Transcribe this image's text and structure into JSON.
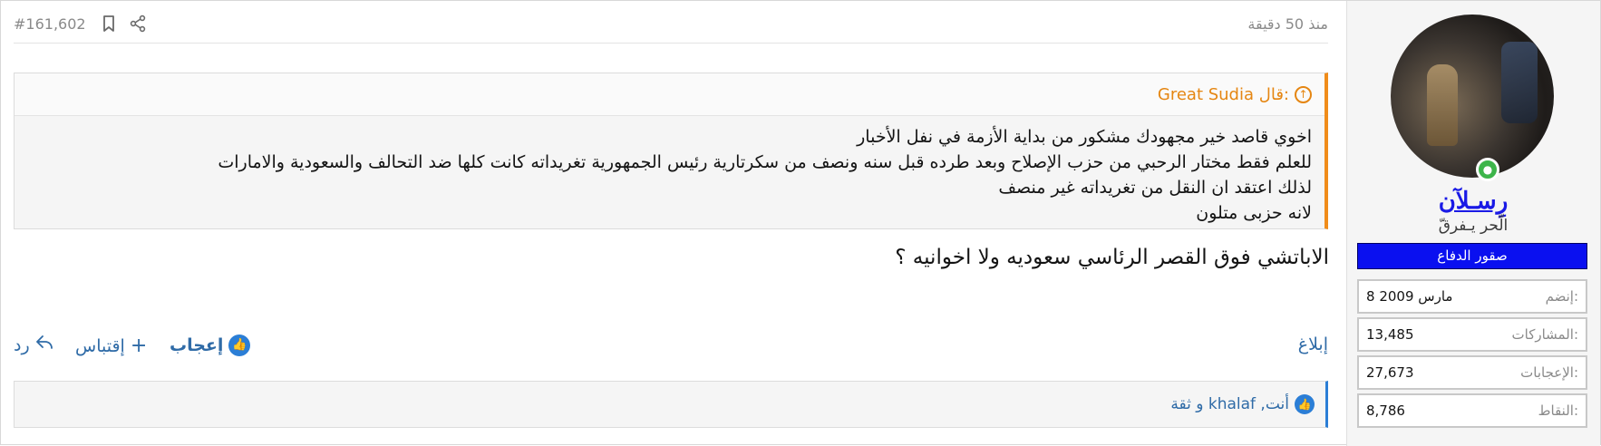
{
  "post": {
    "time": "منذ 50 دقيقة",
    "number": "#161,602",
    "bookmark_icon": "bookmark-icon",
    "share_icon": "share-icon"
  },
  "user": {
    "name": "رِسـلآن",
    "title": "الّحر يـفرقّ",
    "banner": "صقور الدفاع",
    "stats": [
      {
        "label": "إنضم:",
        "value": "8 مارس 2009"
      },
      {
        "label": "المشاركات:",
        "value": "13,485"
      },
      {
        "label": "الإعجابات:",
        "value": "27,673"
      },
      {
        "label": "النقاط:",
        "value": "8,786"
      }
    ]
  },
  "quote": {
    "author": "Great Sudia قال:",
    "lines": [
      "اخوي قاصد خير مجهودك مشكور من بداية الأزمة في نفل الأخبار",
      "للعلم فقط مختار الرحبي من حزب الإصلاح وبعد طرده قبل سنه ونصف من سكرتارية رئيس الجمهورية تغريداته كانت كلها ضد التحالف والسعودية والامارات",
      "لذلك اعتقد ان النقل من تغريداته غير منصف",
      "لانه حزبى متلون"
    ]
  },
  "message": "الاباتشي فوق القصر الرئاسي سعوديه ولا اخوانيه ؟",
  "actions": {
    "report": "إبلاغ",
    "like": "إعجاب",
    "quote": "إقتباس",
    "reply": "رد"
  },
  "likes": {
    "text": "أنت, khalaf و ثقة"
  },
  "colors": {
    "accent": "#2f6ba7",
    "quote_border": "#f08c1a",
    "banner": "#0a10f0",
    "username": "#1a1ae6"
  }
}
